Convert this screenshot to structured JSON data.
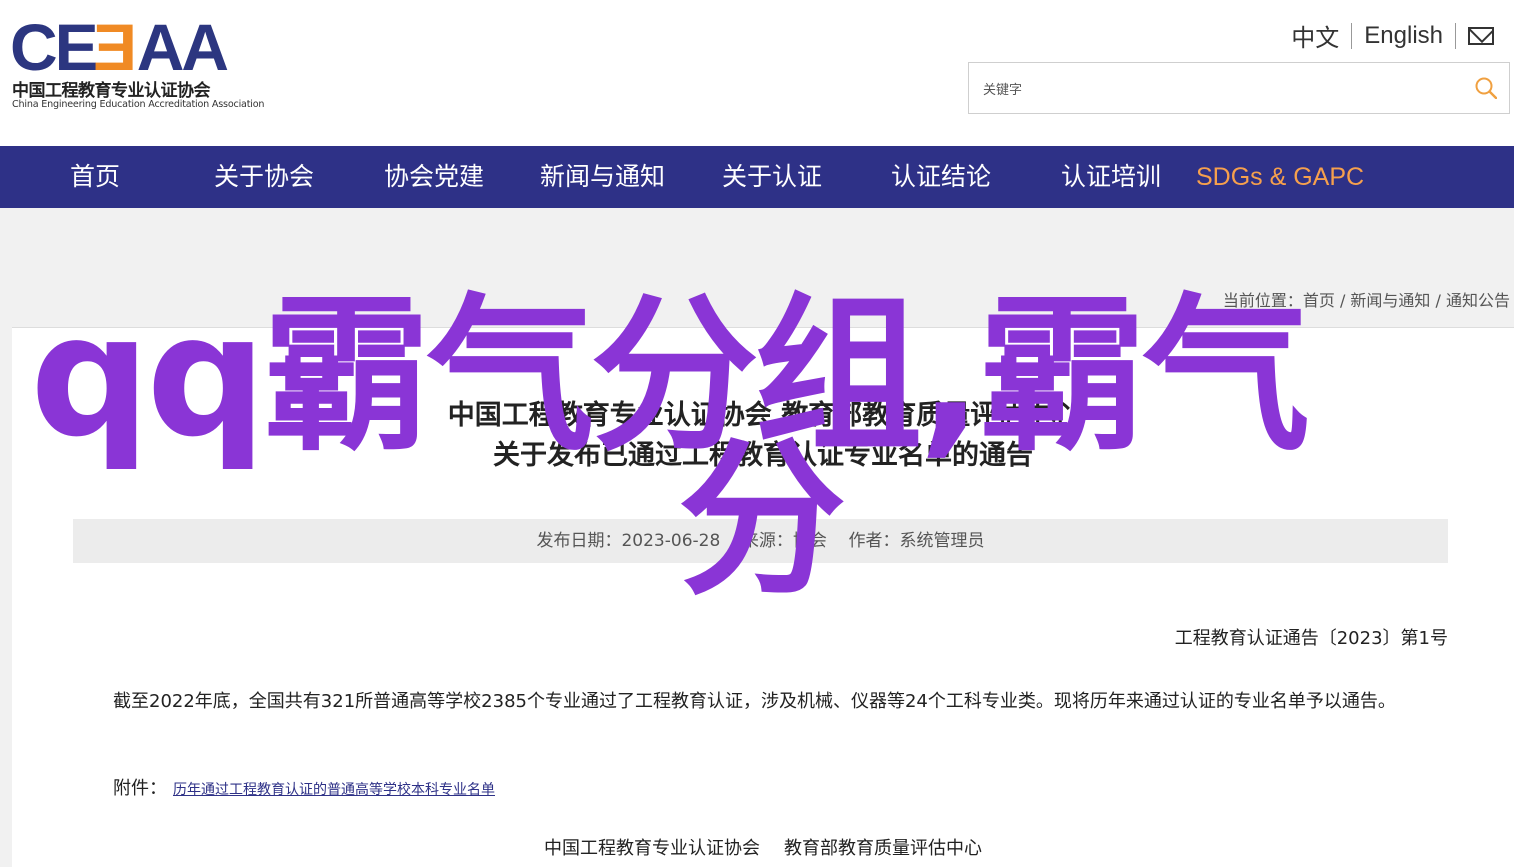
{
  "header": {
    "logo_mark_left": "CE",
    "logo_mark_mid": "E",
    "logo_mark_right": "AA",
    "logo_cn": "中国工程教育专业认证协会",
    "logo_en": "China Engineering Education Accreditation Association",
    "lang_cn": "中文",
    "lang_en": "English",
    "search_placeholder": "关键字"
  },
  "nav": {
    "items": [
      "首页",
      "关于协会",
      "协会党建",
      "新闻与通知",
      "关于认证",
      "认证结论",
      "认证培训",
      "SDGs & GAPC"
    ]
  },
  "breadcrumb": "当前位置：首页 / 新闻与通知 / 通知公告",
  "article": {
    "title_line1": "中国工程教育专业认证协会 教育部教育质量评估中心",
    "title_line2": "关于发布已通过工程教育认证专业名单的通告",
    "meta": "发布日期：2023-06-28    来源：协会    作者：系统管理员",
    "doc_no": "工程教育认证通告〔2023〕第1号",
    "paragraph": "截至2022年底，全国共有321所普通高等学校2385个专业通过了工程教育认证，涉及机械、仪器等24个工科专业类。现将历年来通过认证的专业名单予以通告。",
    "attach_label": "附件：",
    "attach_link": "历年通过工程教育认证的普通高等学校本科专业名单",
    "sign_1": "中国工程教育专业认证协会",
    "sign_2": "教育部教育质量评估中心"
  },
  "overlay": {
    "line1": "qq霸气分组,霸气",
    "line2": "分"
  },
  "colors": {
    "nav_bg": "#2e3187",
    "nav_accent": "#f6a04d",
    "overlay": "#8a35d6",
    "logo_blue": "#2c3680",
    "logo_orange": "#f08a24"
  }
}
